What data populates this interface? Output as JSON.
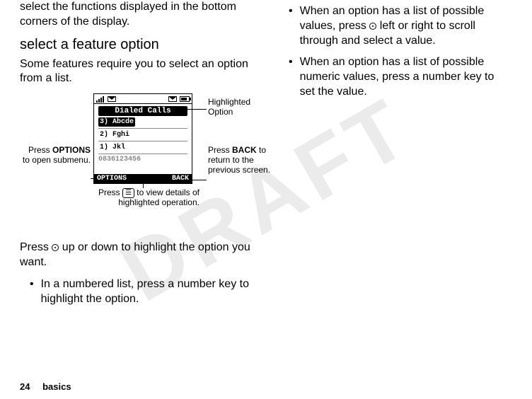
{
  "watermark": "DRAFT",
  "left": {
    "lead_in": "select the functions displayed in the bottom corners of the display.",
    "heading": "select a feature option",
    "intro": "Some features require you to select an option from a list.",
    "after_fig": "Press ",
    "after_fig2": " up or down to highlight the option you want.",
    "bullets": [
      "In a numbered list, press a number key to highlight the option."
    ]
  },
  "right": {
    "bullets": [
      "When an option has a list of possible values, press ",
      " left or right to scroll through and select a value.",
      "When an option has a list of possible numeric values, press a number key to set the value."
    ]
  },
  "fig": {
    "screen_title": "Dialed Calls",
    "items": [
      "3) Abcde",
      "2) Fghi",
      "1) Jkl"
    ],
    "number_line": "0836123456",
    "soft_left": "OPTIONS",
    "soft_right": "BACK",
    "callout_hl": "Highlighted Option",
    "callout_left_1": "Press ",
    "callout_left_b": "OPTIONS",
    "callout_left_2": " to open submenu.",
    "callout_right_1": "Press ",
    "callout_right_b": "BACK",
    "callout_right_2": " to return to the previous screen.",
    "callout_bottom_1": "Press ",
    "callout_bottom_key": "☰",
    "callout_bottom_2": " to view details of highlighted operation."
  },
  "footer": {
    "page": "24",
    "section": "basics"
  }
}
